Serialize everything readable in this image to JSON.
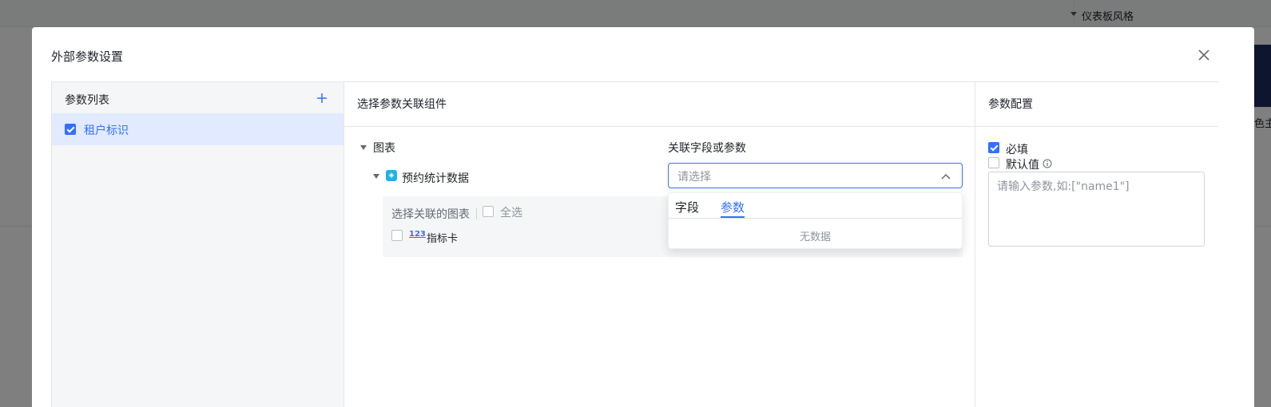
{
  "background": {
    "style_section_label": "仪表板风格",
    "thumb_text": "色主"
  },
  "dialog": {
    "title": "外部参数设置"
  },
  "param_list": {
    "header": "参数列表",
    "items": [
      {
        "label": "租户标识",
        "checked": true
      }
    ]
  },
  "components": {
    "header": "选择参数关联组件",
    "tree_root": "图表",
    "dataset": "预约统计数据",
    "chart_box": {
      "title": "选择关联的图表",
      "select_all": "全选",
      "charts": [
        {
          "icon_text": "123",
          "label": "指标卡",
          "checked": false
        }
      ]
    },
    "field_label": "关联字段或参数",
    "select_placeholder": "请选择",
    "dropdown": {
      "tabs": [
        "字段",
        "参数"
      ],
      "active_tab": "参数",
      "empty_text": "无数据"
    }
  },
  "config": {
    "header": "参数配置",
    "required_label": "必填",
    "required_checked": true,
    "default_label": "默认值",
    "default_checked": false,
    "default_placeholder": "请输入参数,如:[\"name1\"]"
  },
  "colors": {
    "accent": "#3370ff",
    "selected_bg": "#e1eaff",
    "dataset_icon": "#1fb2e8"
  }
}
